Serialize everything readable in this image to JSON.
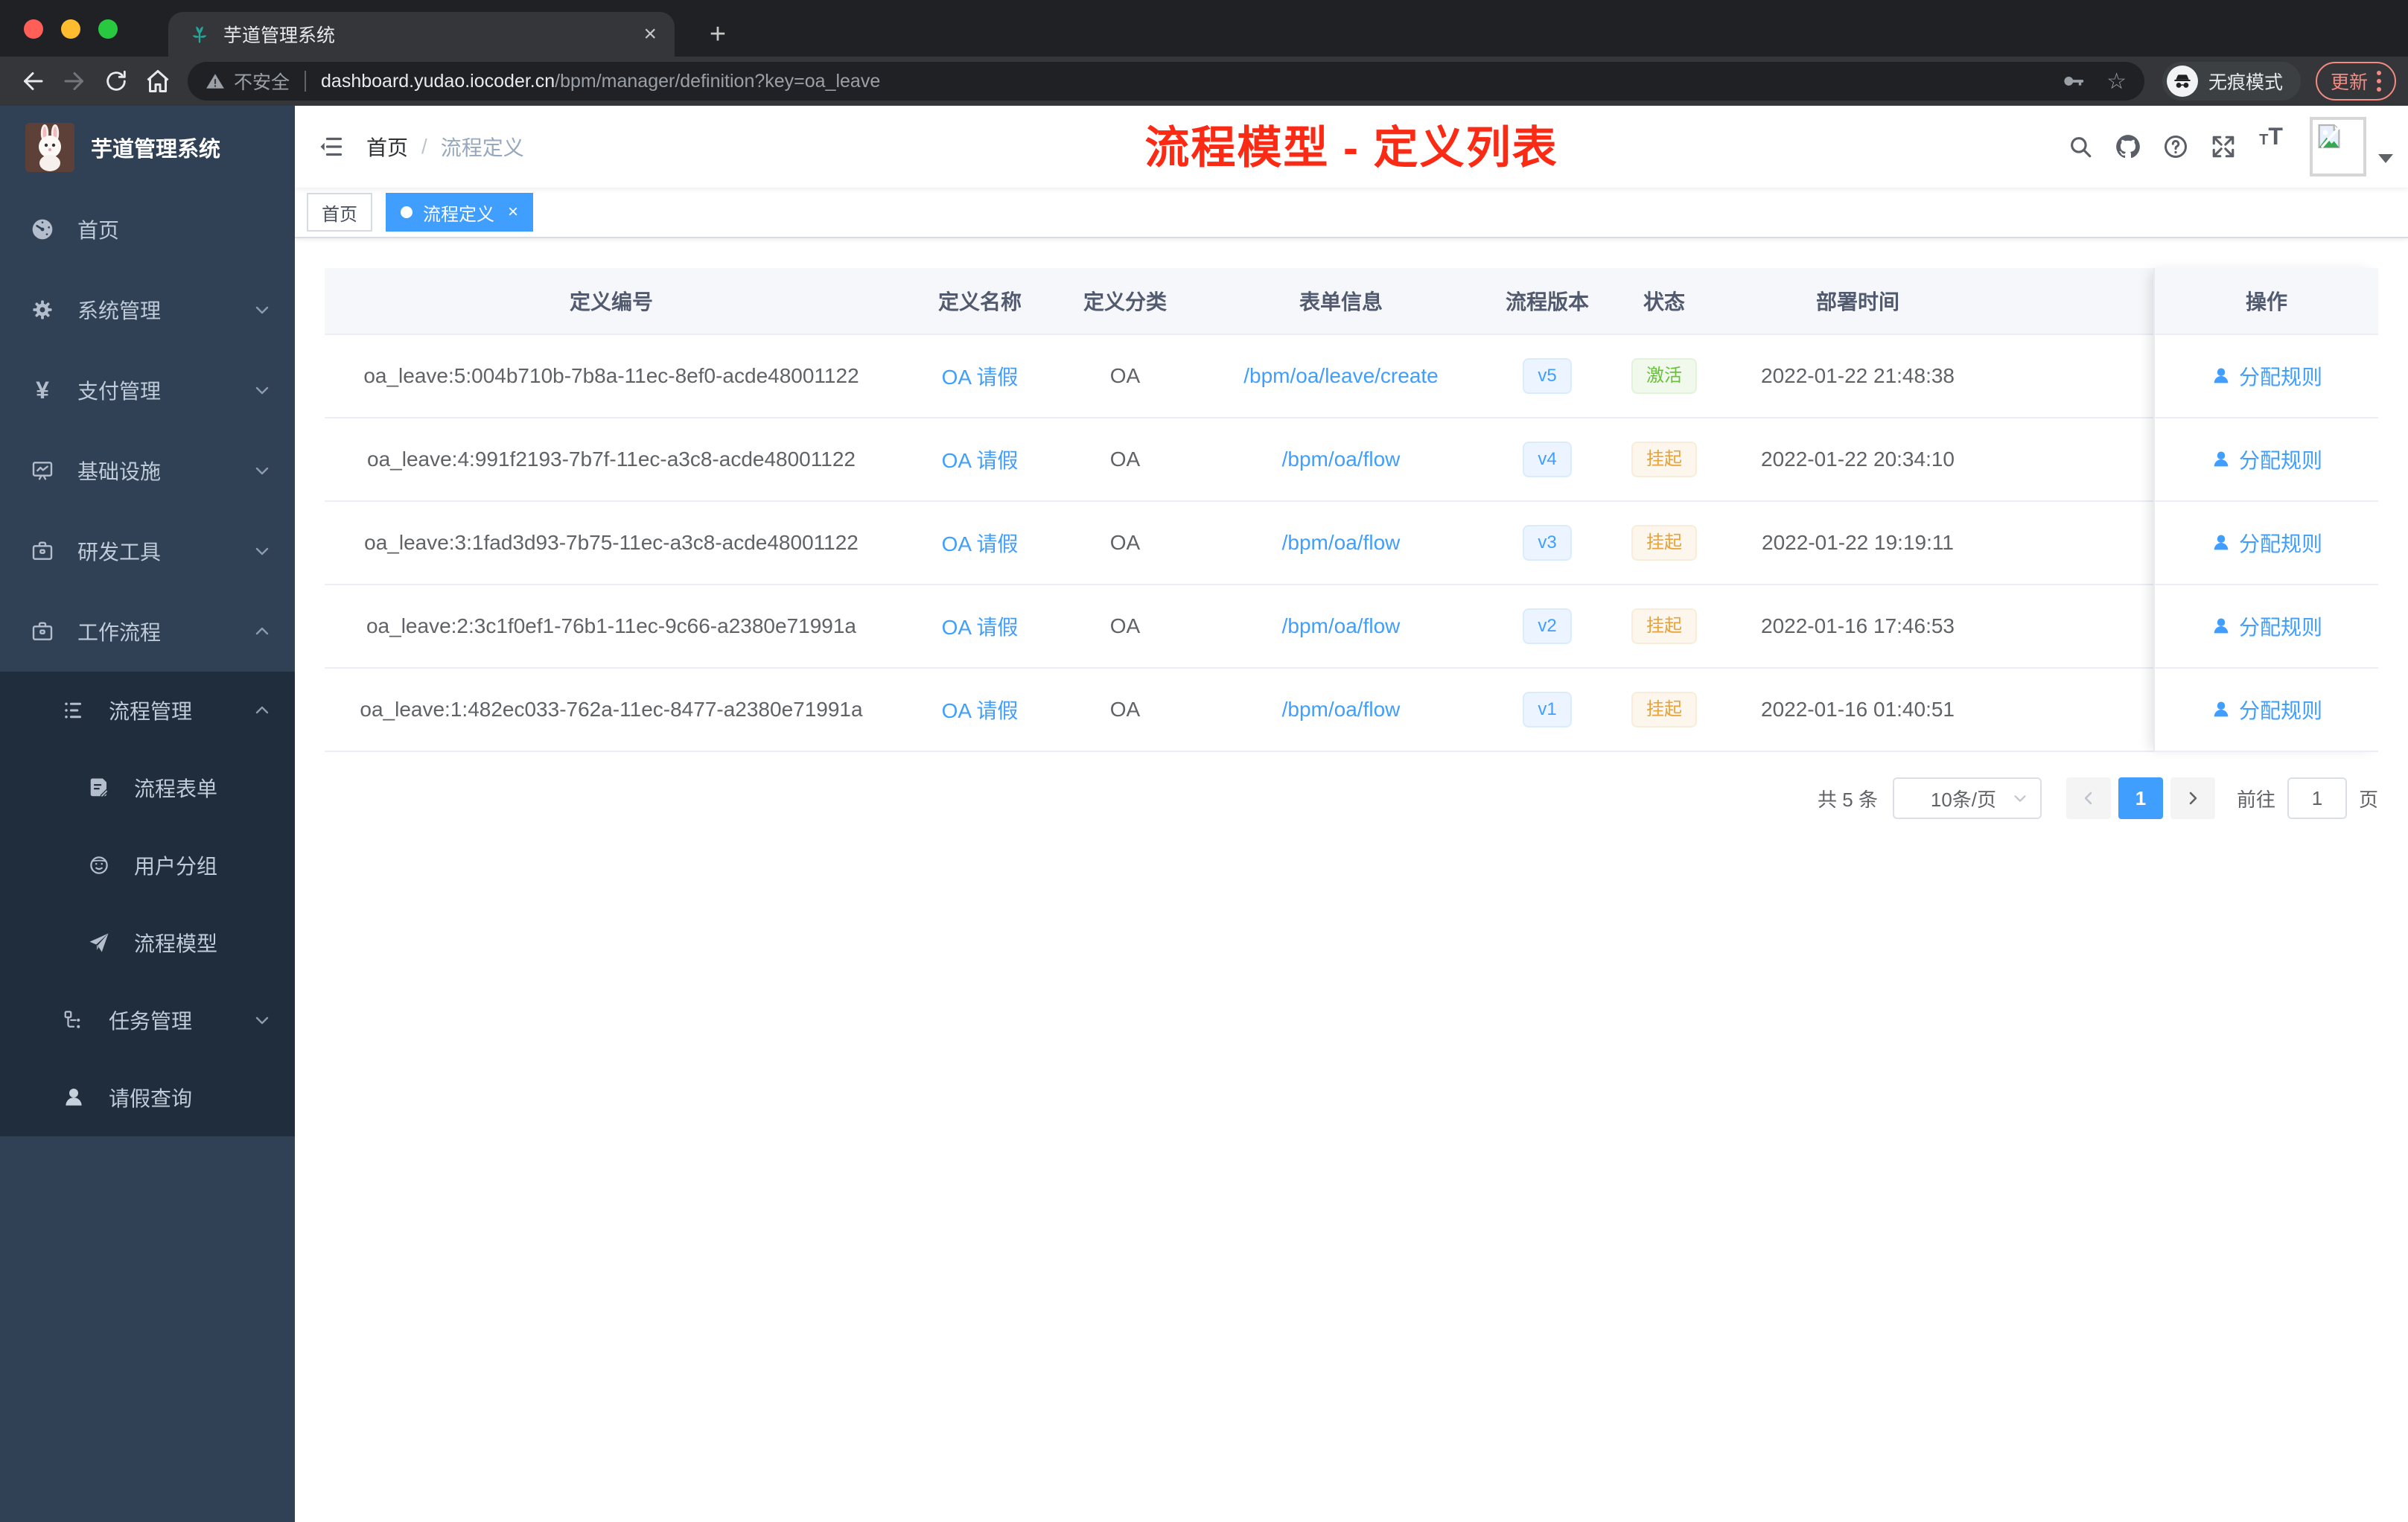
{
  "browser": {
    "tab_title": "芋道管理系统",
    "close_tab": "×",
    "new_tab": "+",
    "not_secure": "不安全",
    "url_domain": "dashboard.yudao.iocoder.cn",
    "url_path": "/bpm/manager/definition?key=oa_leave",
    "incognito_label": "无痕模式",
    "update_label": "更新",
    "colors": {
      "update_accent": "#f28b82",
      "traffic_red": "#ff5f57",
      "traffic_yellow": "#febc2e",
      "traffic_green": "#28c840"
    }
  },
  "sidebar": {
    "logo_title": "芋道管理系统",
    "items": [
      {
        "label": "首页",
        "icon": "dashboard-icon"
      },
      {
        "label": "系统管理",
        "icon": "gear-icon",
        "arrow": "down"
      },
      {
        "label": "支付管理",
        "icon": "yen-icon",
        "arrow": "down"
      },
      {
        "label": "基础设施",
        "icon": "monitor-icon",
        "arrow": "down"
      },
      {
        "label": "研发工具",
        "icon": "toolbox-icon",
        "arrow": "down"
      },
      {
        "label": "工作流程",
        "icon": "toolbox-icon",
        "arrow": "up"
      },
      {
        "label": "流程管理",
        "icon": "list-icon",
        "arrow": "up"
      },
      {
        "label": "流程表单",
        "icon": "form-icon"
      },
      {
        "label": "用户分组",
        "icon": "user-group-icon"
      },
      {
        "label": "流程模型",
        "icon": "paper-plane-icon"
      },
      {
        "label": "任务管理",
        "icon": "tree-icon",
        "arrow": "down"
      },
      {
        "label": "请假查询",
        "icon": "person-icon"
      }
    ]
  },
  "navbar": {
    "breadcrumb": {
      "home": "首页",
      "separator": "/",
      "current": "流程定义"
    },
    "annotation": "流程模型 - 定义列表"
  },
  "tags": [
    {
      "label": "首页",
      "active": false
    },
    {
      "label": "流程定义",
      "active": true,
      "close": "×"
    }
  ],
  "table": {
    "columns": [
      "定义编号",
      "定义名称",
      "定义分类",
      "表单信息",
      "流程版本",
      "状态",
      "部署时间",
      "操作"
    ],
    "action_label": "分配规则",
    "rows": [
      {
        "id": "oa_leave:5:004b710b-7b8a-11ec-8ef0-acde48001122",
        "name": "OA 请假",
        "category": "OA",
        "form": "/bpm/oa/leave/create",
        "version": "v5",
        "status": "激活",
        "status_type": "active",
        "time": "2022-01-22 21:48:38"
      },
      {
        "id": "oa_leave:4:991f2193-7b7f-11ec-a3c8-acde48001122",
        "name": "OA 请假",
        "category": "OA",
        "form": "/bpm/oa/flow",
        "version": "v4",
        "status": "挂起",
        "status_type": "suspended",
        "time": "2022-01-22 20:34:10"
      },
      {
        "id": "oa_leave:3:1fad3d93-7b75-11ec-a3c8-acde48001122",
        "name": "OA 请假",
        "category": "OA",
        "form": "/bpm/oa/flow",
        "version": "v3",
        "status": "挂起",
        "status_type": "suspended",
        "time": "2022-01-22 19:19:11"
      },
      {
        "id": "oa_leave:2:3c1f0ef1-76b1-11ec-9c66-a2380e71991a",
        "name": "OA 请假",
        "category": "OA",
        "form": "/bpm/oa/flow",
        "version": "v2",
        "status": "挂起",
        "status_type": "suspended",
        "time": "2022-01-16 17:46:53"
      },
      {
        "id": "oa_leave:1:482ec033-762a-11ec-8477-a2380e71991a",
        "name": "OA 请假",
        "category": "OA",
        "form": "/bpm/oa/flow",
        "version": "v1",
        "status": "挂起",
        "status_type": "suspended",
        "time": "2022-01-16 01:40:51"
      }
    ]
  },
  "pagination": {
    "total": "共 5 条",
    "page_size": "10条/页",
    "current": "1",
    "goto_prefix": "前往",
    "goto_value": "1",
    "goto_suffix": "页"
  },
  "colors": {
    "accent_blue": "#409eff",
    "success_green": "#67c23a",
    "warning_yellow": "#e6a23c",
    "annotation_red": "#fb2a14",
    "sidebar_bg": "#304156",
    "submenu_bg": "#1f2d3d"
  }
}
